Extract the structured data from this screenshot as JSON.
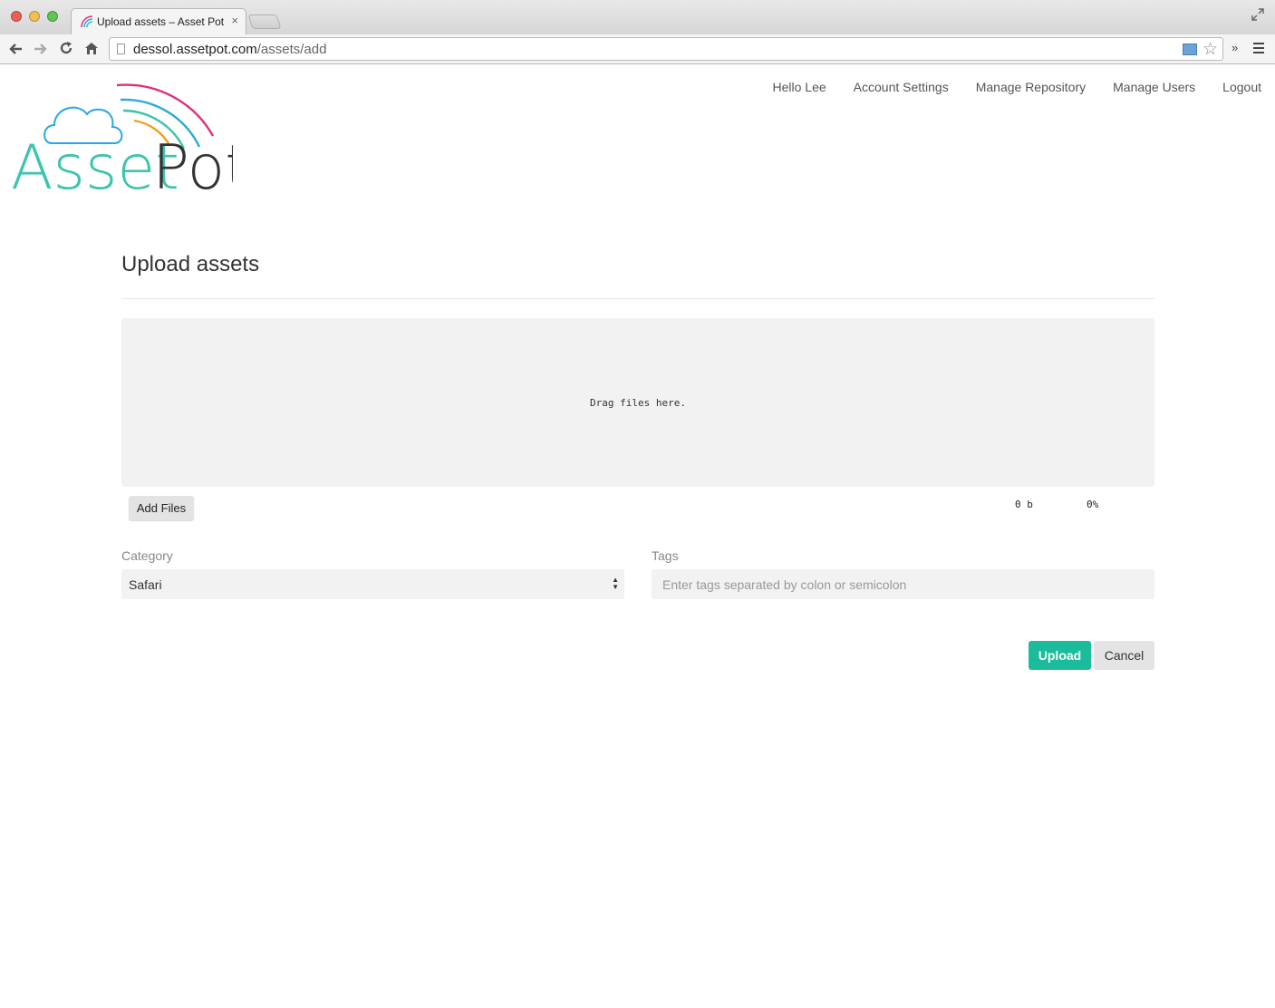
{
  "browser": {
    "tab_title": "Upload assets – Asset Pot",
    "tab_close": "×",
    "url_host": "dessol.assetpot.com",
    "url_path": "/assets/add",
    "icons": [
      "back-arrow-icon",
      "forward-arrow-icon",
      "reload-icon",
      "home-icon",
      "page-icon",
      "star-icon",
      "menu-icon",
      "fullscreen-icon"
    ]
  },
  "header": {
    "logo_text_part1": "Asset",
    "logo_text_part2": "Pot",
    "nav": [
      "Hello Lee",
      "Account Settings",
      "Manage Repository",
      "Manage Users",
      "Logout"
    ]
  },
  "main": {
    "title": "Upload assets",
    "dropzone_text": "Drag files here.",
    "add_files_label": "Add Files",
    "total_size": "0 b",
    "progress": "0%",
    "category_label": "Category",
    "category_value": "Safari",
    "tags_label": "Tags",
    "tags_placeholder": "Enter tags separated by colon or semicolon",
    "upload_label": "Upload",
    "cancel_label": "Cancel"
  },
  "colors": {
    "accent": "#1abc9c",
    "logo_teal": "#3cc4ad",
    "logo_blue": "#29a8e0",
    "logo_pink": "#e0307a",
    "logo_orange": "#f0a020"
  }
}
